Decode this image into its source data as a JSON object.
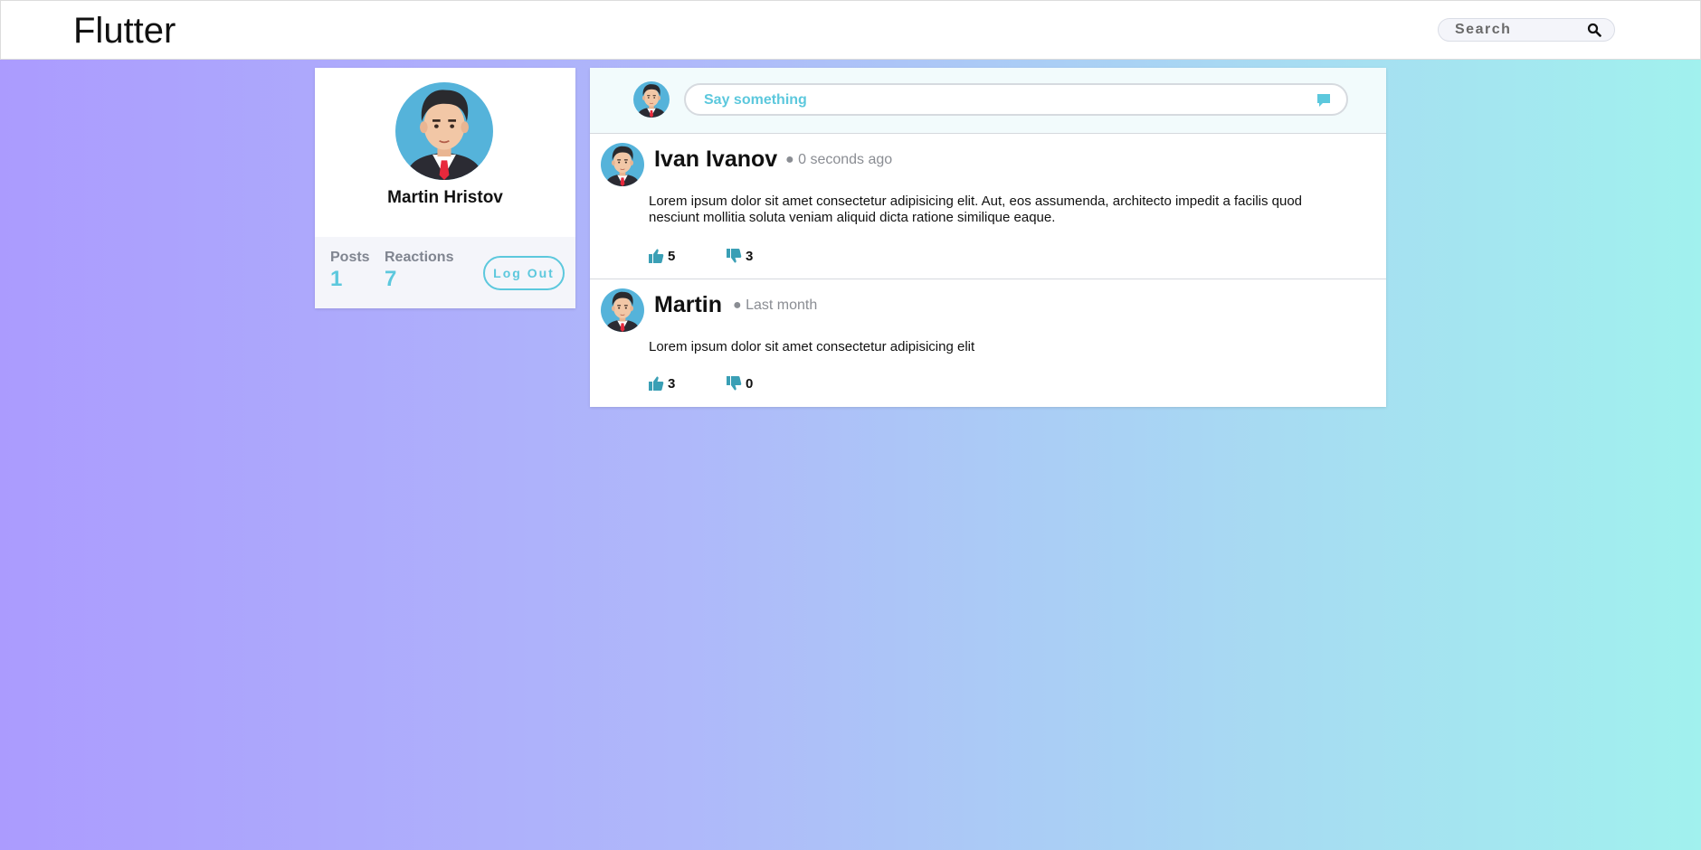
{
  "header": {
    "brand": "Flutter",
    "search_placeholder": "Search"
  },
  "profile": {
    "name": "Martin Hristov",
    "posts_label": "Posts",
    "posts_count": "1",
    "reactions_label": "Reactions",
    "reactions_count": "7",
    "logout_label": "Log Out"
  },
  "composer": {
    "placeholder": "Say something"
  },
  "posts": [
    {
      "author": "Ivan Ivanov",
      "time": "● 0 seconds ago",
      "body": "Lorem ipsum dolor sit amet consectetur adipisicing elit. Aut, eos assumenda, architecto impedit a facilis quod nesciunt mollitia soluta veniam aliquid dicta ratione similique eaque.",
      "likes": "5",
      "dislikes": "3"
    },
    {
      "author": "Martin",
      "time": "● Last month",
      "body": "Lorem ipsum dolor sit amet consectetur adipisicing elit",
      "likes": "3",
      "dislikes": "0"
    }
  ],
  "colors": {
    "accent": "#5cc8dd",
    "reaction_icon": "#3a9fb5",
    "gradient_start": "#ab9bfe",
    "gradient_end": "#a1f1ee"
  },
  "icons": {
    "search": "search-icon",
    "comment": "comment-icon",
    "like": "thumbs-up-icon",
    "dislike": "thumbs-down-icon",
    "avatar": "user-avatar"
  }
}
